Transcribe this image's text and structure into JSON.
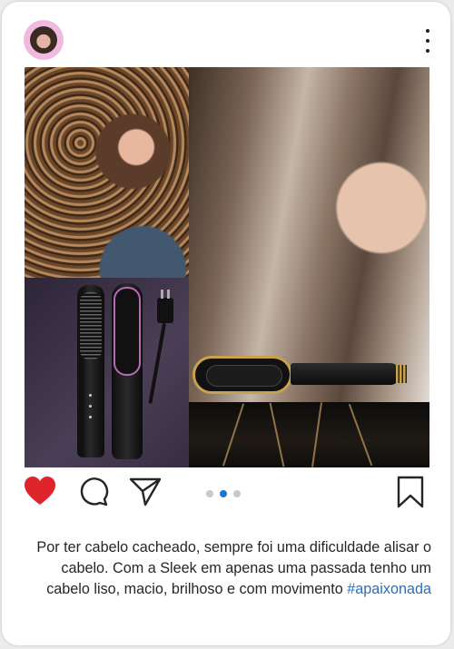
{
  "post": {
    "avatar_alt": "profile-avatar",
    "menu_icon": "more-vertical-icon",
    "caption": {
      "text": "Por ter cabelo cacheado, sempre foi uma dificuldade alisar o cabelo. Com a Sleek em apenas uma passada tenho um cabelo liso, macio, brilhoso e com movimento",
      "hashtag": "#apaixonada"
    },
    "carousel": {
      "count": 3,
      "active_index": 1
    }
  },
  "actions": {
    "like_icon": "heart-filled-icon",
    "comment_icon": "comment-icon",
    "share_icon": "send-icon",
    "save_icon": "bookmark-icon",
    "liked": true
  },
  "colors": {
    "like": "#e0242c",
    "hashtag": "#2b6fb8",
    "active_dot": "#1a79c9",
    "inactive_dot": "#c8c8c8",
    "text": "#262626"
  }
}
